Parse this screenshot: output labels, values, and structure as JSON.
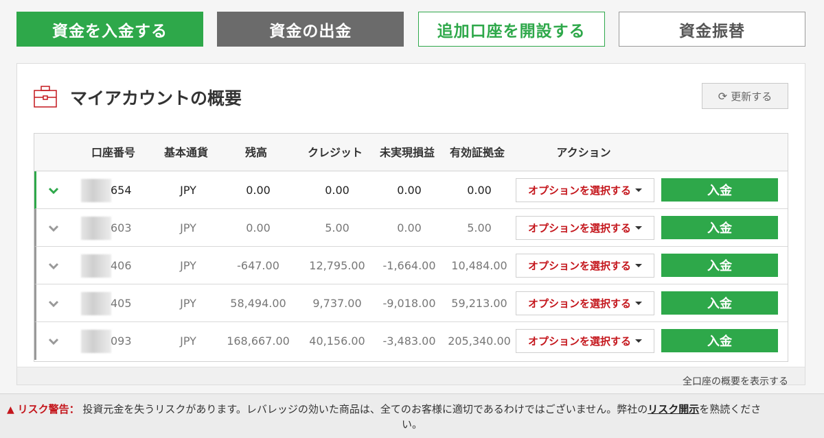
{
  "top_buttons": {
    "deposit": "資金を入金する",
    "withdraw": "資金の出金",
    "open_account": "追加口座を開設する",
    "transfer": "資金振替"
  },
  "panel": {
    "title": "マイアカウントの概要",
    "refresh_label": "更新する",
    "show_all": "全口座の概要を表示する"
  },
  "table": {
    "headers": [
      "口座番号",
      "基本通貨",
      "残高",
      "クレジット",
      "未実現損益",
      "有効証拠金",
      "アクション"
    ],
    "select_label": "オプションを選択する",
    "deposit_label": "入金",
    "rows": [
      {
        "account": "654",
        "currency": "JPY",
        "balance": "0.00",
        "credit": "0.00",
        "unrealized": "0.00",
        "equity": "0.00"
      },
      {
        "account": "603",
        "currency": "JPY",
        "balance": "0.00",
        "credit": "5.00",
        "unrealized": "0.00",
        "equity": "5.00"
      },
      {
        "account": "406",
        "currency": "JPY",
        "balance": "-647.00",
        "credit": "12,795.00",
        "unrealized": "-1,664.00",
        "equity": "10,484.00"
      },
      {
        "account": "405",
        "currency": "JPY",
        "balance": "58,494.00",
        "credit": "9,737.00",
        "unrealized": "-9,018.00",
        "equity": "59,213.00"
      },
      {
        "account": "093",
        "currency": "JPY",
        "balance": "168,667.00",
        "credit": "40,156.00",
        "unrealized": "-3,483.00",
        "equity": "205,340.00"
      }
    ]
  },
  "risk": {
    "label": "リスク警告：",
    "text_before": "投資元金を失うリスクがあります。レバレッジの効いた商品は、全てのお客様に適切であるわけではございません。弊社の",
    "link": "リスク開示",
    "text_after": "を熟読くださ",
    "text_tail": "い。"
  },
  "colors": {
    "accent_green": "#2ea84a",
    "warning_red": "#c4161c",
    "withdraw_gray": "#6b6b6b"
  }
}
